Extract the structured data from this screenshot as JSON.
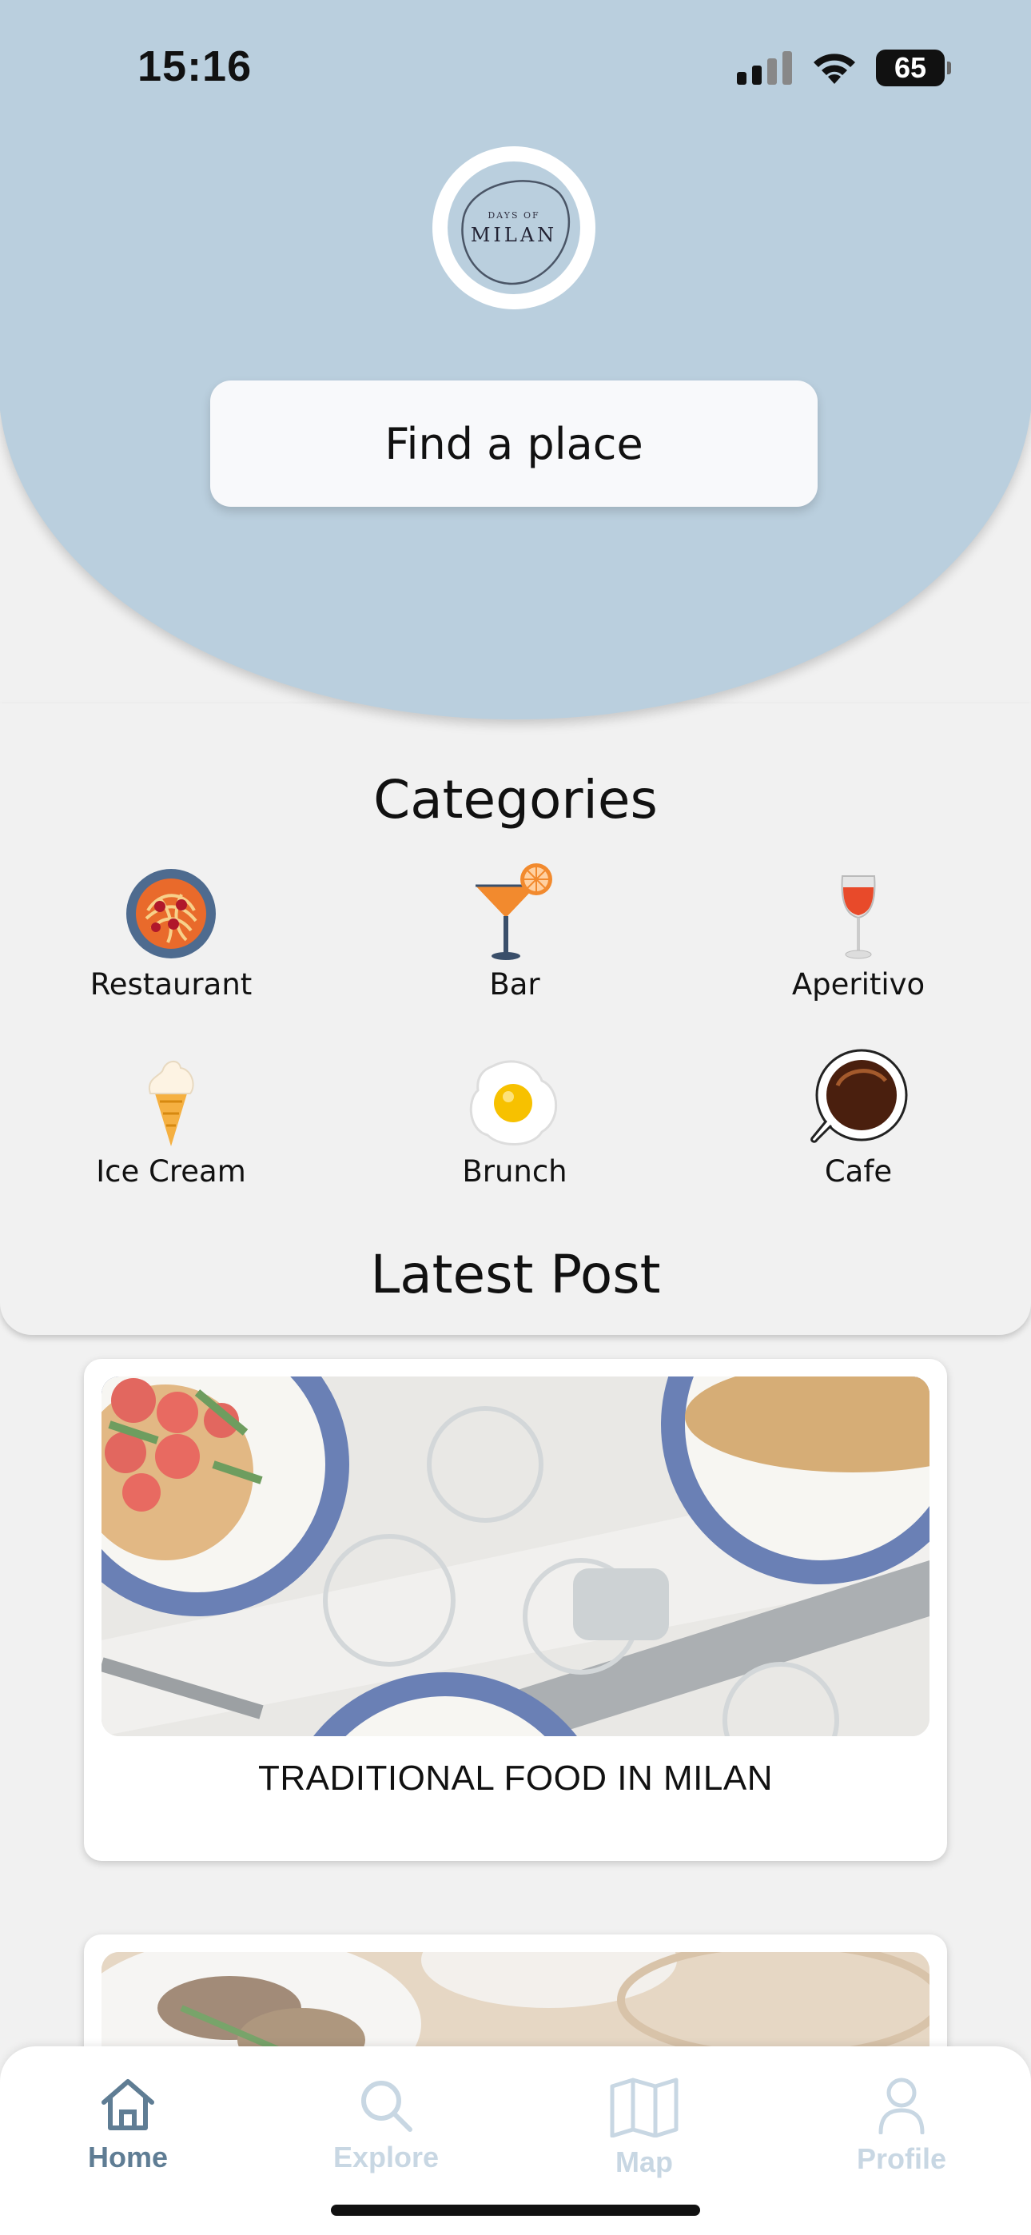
{
  "status": {
    "time": "15:16",
    "battery": "65"
  },
  "logo": {
    "small": "DAYS OF",
    "big": "MILAN"
  },
  "search": {
    "label": "Find a place"
  },
  "categories": {
    "title": "Categories",
    "items": [
      {
        "label": "Restaurant",
        "icon": "spaghetti-plate-icon"
      },
      {
        "label": "Bar",
        "icon": "cocktail-icon"
      },
      {
        "label": "Aperitivo",
        "icon": "wine-glass-icon"
      },
      {
        "label": "Ice Cream",
        "icon": "ice-cream-cone-icon"
      },
      {
        "label": "Brunch",
        "icon": "fried-egg-icon"
      },
      {
        "label": "Cafe",
        "icon": "coffee-cup-icon"
      }
    ]
  },
  "latest": {
    "title": "Latest Post",
    "posts": [
      {
        "title": "TRADITIONAL FOOD IN MILAN"
      },
      {
        "title": ""
      }
    ]
  },
  "tabbar": {
    "items": [
      {
        "label": "Home",
        "icon": "home-icon",
        "active": true
      },
      {
        "label": "Explore",
        "icon": "search-icon",
        "active": false
      },
      {
        "label": "Map",
        "icon": "map-icon",
        "active": false
      },
      {
        "label": "Profile",
        "icon": "person-icon",
        "active": false
      }
    ],
    "active_color": "#5f7d94",
    "inactive_color": "#c8d7e3"
  },
  "colors": {
    "hero": "#bacfde",
    "background": "#f1f1f1"
  }
}
